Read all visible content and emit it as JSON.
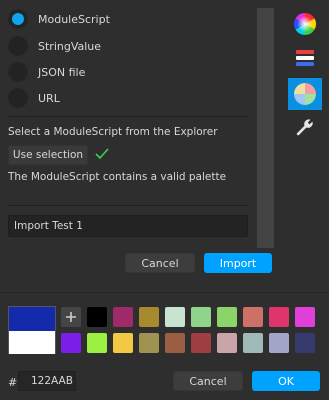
{
  "import_types": [
    {
      "label": "ModuleScript",
      "selected": true
    },
    {
      "label": "StringValue",
      "selected": false
    },
    {
      "label": "JSON file",
      "selected": false
    },
    {
      "label": "URL",
      "selected": false
    }
  ],
  "module_prompt": "Select a ModuleScript from the Explorer",
  "use_selection_label": "Use selection",
  "status_text": "The ModuleScript contains a valid palette",
  "palette_name": "Import Test 1",
  "import_dialog": {
    "cancel_label": "Cancel",
    "import_label": "Import"
  },
  "tabs": [
    {
      "icon": "color-wheel-icon",
      "selected": false
    },
    {
      "icon": "palette-list-icon",
      "selected": false
    },
    {
      "icon": "pastel-wheel-icon",
      "selected": true
    },
    {
      "icon": "wrench-icon",
      "selected": false
    }
  ],
  "color_preview": {
    "new": "#122AAB",
    "old": "#FFFFFF"
  },
  "swatches_row1": [
    "#000000",
    "#9e2a6a",
    "#a88a2e",
    "#c8e3d0",
    "#8fd48a",
    "#8bd46a",
    "#cd7068",
    "#e0356c",
    "#e040d8"
  ],
  "swatches_row2": [
    "#7a1ee8",
    "#9cf044",
    "#f3c845",
    "#a09250",
    "#9a5e42",
    "#9e3e42",
    "#c9a4a8",
    "#9fb8b8",
    "#a2a5c8",
    "#363a6c"
  ],
  "hex_label": "#",
  "hex_value": "122AAB",
  "footer": {
    "cancel_label": "Cancel",
    "ok_label": "OK"
  },
  "colors": {
    "accent": "#00A2FF",
    "background": "#2E2E2E"
  }
}
